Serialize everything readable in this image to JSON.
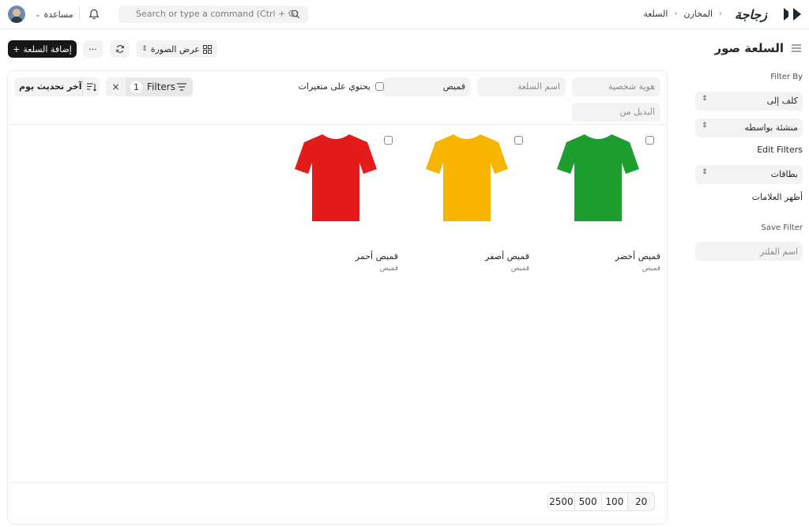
{
  "navbar": {
    "help_label": "مساعدة",
    "search_placeholder": "Search or type a command (Ctrl + G)",
    "breadcrumbs": [
      "السلعة",
      "المخازن"
    ],
    "logo_text": "زجاجة"
  },
  "page": {
    "title": "السلعة صور",
    "add_button_label": "إضافة السلعة",
    "more_button_label": "···",
    "view_button_label": "عرض الصورة"
  },
  "sidebar": {
    "filter_by_label": "Filter By",
    "assigned_to_label": "كلف إلى",
    "created_by_label": "منشئة بواسطه",
    "edit_filters_label": "Edit Filters",
    "tags_label": "بطاقات",
    "show_tags_label": "أظهر العلامات",
    "save_filter_label": "Save Filter",
    "filter_name_placeholder": "اسم الفلتر"
  },
  "filters": {
    "id_placeholder": "هوية شخصية",
    "item_name_placeholder": "اسم السلعة",
    "item_group_value": "قميص",
    "has_variants_label": "يحتوي على متغيرات",
    "variant_of_placeholder": "البديل من",
    "filters_label": "Filters",
    "filters_count": "1",
    "sort_label": "آخر تحديث يوم"
  },
  "items": [
    {
      "title": "قميص أخضر",
      "subtitle": "قميص",
      "color": "#1e9e2f"
    },
    {
      "title": "قميص أصفر",
      "subtitle": "قميص",
      "color": "#f7b500"
    },
    {
      "title": "قميص أحمر",
      "subtitle": "قميص",
      "color": "#e31b1b"
    }
  ],
  "paging": [
    "20",
    "100",
    "500",
    "2500"
  ]
}
